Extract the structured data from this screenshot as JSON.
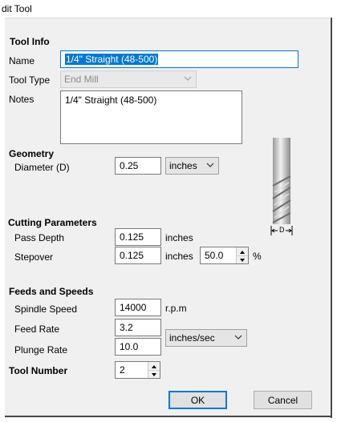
{
  "window": {
    "title": "dit Tool"
  },
  "tool_info": {
    "header": "Tool Info",
    "name_label": "Name",
    "name_value": "1/4\" Straight (48-500)",
    "tool_type_label": "Tool Type",
    "tool_type_value": "End Mill",
    "notes_label": "Notes",
    "notes_value": "1/4\" Straight (48-500)"
  },
  "geometry": {
    "header": "Geometry",
    "diameter_label": "Diameter (D)",
    "diameter_value": "0.25",
    "units_value": "inches"
  },
  "cutting": {
    "header": "Cutting Parameters",
    "pass_depth_label": "Pass Depth",
    "pass_depth_value": "0.125",
    "pass_depth_unit": "inches",
    "stepover_label": "Stepover",
    "stepover_value": "0.125",
    "stepover_unit": "inches",
    "stepover_percent_value": "50.0",
    "percent_sign": "%"
  },
  "feeds": {
    "header": "Feeds and Speeds",
    "spindle_label": "Spindle Speed",
    "spindle_value": "14000",
    "spindle_unit": "r.p.m",
    "feed_label": "Feed Rate",
    "feed_value": "3.2",
    "plunge_label": "Plunge Rate",
    "plunge_value": "10.0",
    "rate_units_value": "inches/sec"
  },
  "tool_number": {
    "label": "Tool Number",
    "value": "2"
  },
  "diagram": {
    "d_label": "D"
  },
  "buttons": {
    "ok": "OK",
    "cancel": "Cancel"
  },
  "colors": {
    "focus": "#0078d7",
    "dialog_bg": "#f0f0f0"
  },
  "icons": [
    "dropdown-arrow-icon",
    "spin-up-icon",
    "spin-down-icon",
    "end-mill-diagram"
  ]
}
